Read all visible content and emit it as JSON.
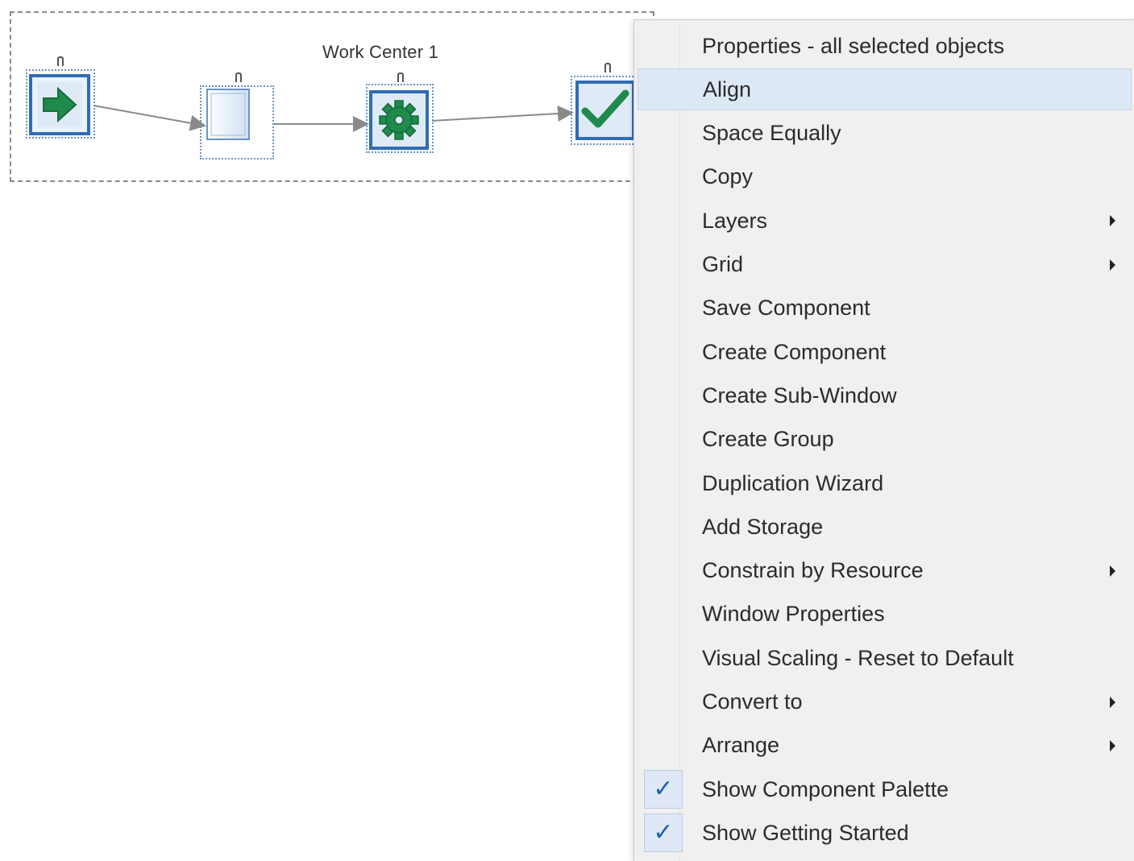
{
  "canvas": {
    "group_label": "Work Center 1",
    "nodes": [
      {
        "name": "entry-node",
        "icon": "right-arrow-icon"
      },
      {
        "name": "queue-node",
        "icon": "queue-icon"
      },
      {
        "name": "work-center-node",
        "icon": "gear-icon"
      },
      {
        "name": "exit-node",
        "icon": "checkmark-icon"
      }
    ]
  },
  "context_menu": {
    "items": [
      {
        "label": "Properties - all selected objects",
        "submenu": false,
        "checked": false
      },
      {
        "label": "Align",
        "submenu": false,
        "checked": false,
        "highlighted": true
      },
      {
        "label": "Space Equally",
        "submenu": false,
        "checked": false
      },
      {
        "label": "Copy",
        "submenu": false,
        "checked": false
      },
      {
        "label": "Layers",
        "submenu": true,
        "checked": false
      },
      {
        "label": "Grid",
        "submenu": true,
        "checked": false
      },
      {
        "label": "Save Component",
        "submenu": false,
        "checked": false
      },
      {
        "label": "Create Component",
        "submenu": false,
        "checked": false
      },
      {
        "label": "Create Sub-Window",
        "submenu": false,
        "checked": false
      },
      {
        "label": "Create Group",
        "submenu": false,
        "checked": false
      },
      {
        "label": "Duplication Wizard",
        "submenu": false,
        "checked": false
      },
      {
        "label": "Add Storage",
        "submenu": false,
        "checked": false
      },
      {
        "label": "Constrain by Resource",
        "submenu": true,
        "checked": false
      },
      {
        "label": "Window Properties",
        "submenu": false,
        "checked": false
      },
      {
        "label": "Visual Scaling - Reset to Default",
        "submenu": false,
        "checked": false
      },
      {
        "label": "Convert to",
        "submenu": true,
        "checked": false
      },
      {
        "label": "Arrange",
        "submenu": true,
        "checked": false
      },
      {
        "label": "Show Component Palette",
        "submenu": false,
        "checked": true
      },
      {
        "label": "Show Getting Started",
        "submenu": false,
        "checked": true
      }
    ],
    "check_glyph": "✓"
  },
  "colors": {
    "accent_blue": "#2f6db5",
    "node_fill_green": "#1f8a4c",
    "menu_bg": "#f0f0f0",
    "highlight_bg": "#dde8f5"
  }
}
